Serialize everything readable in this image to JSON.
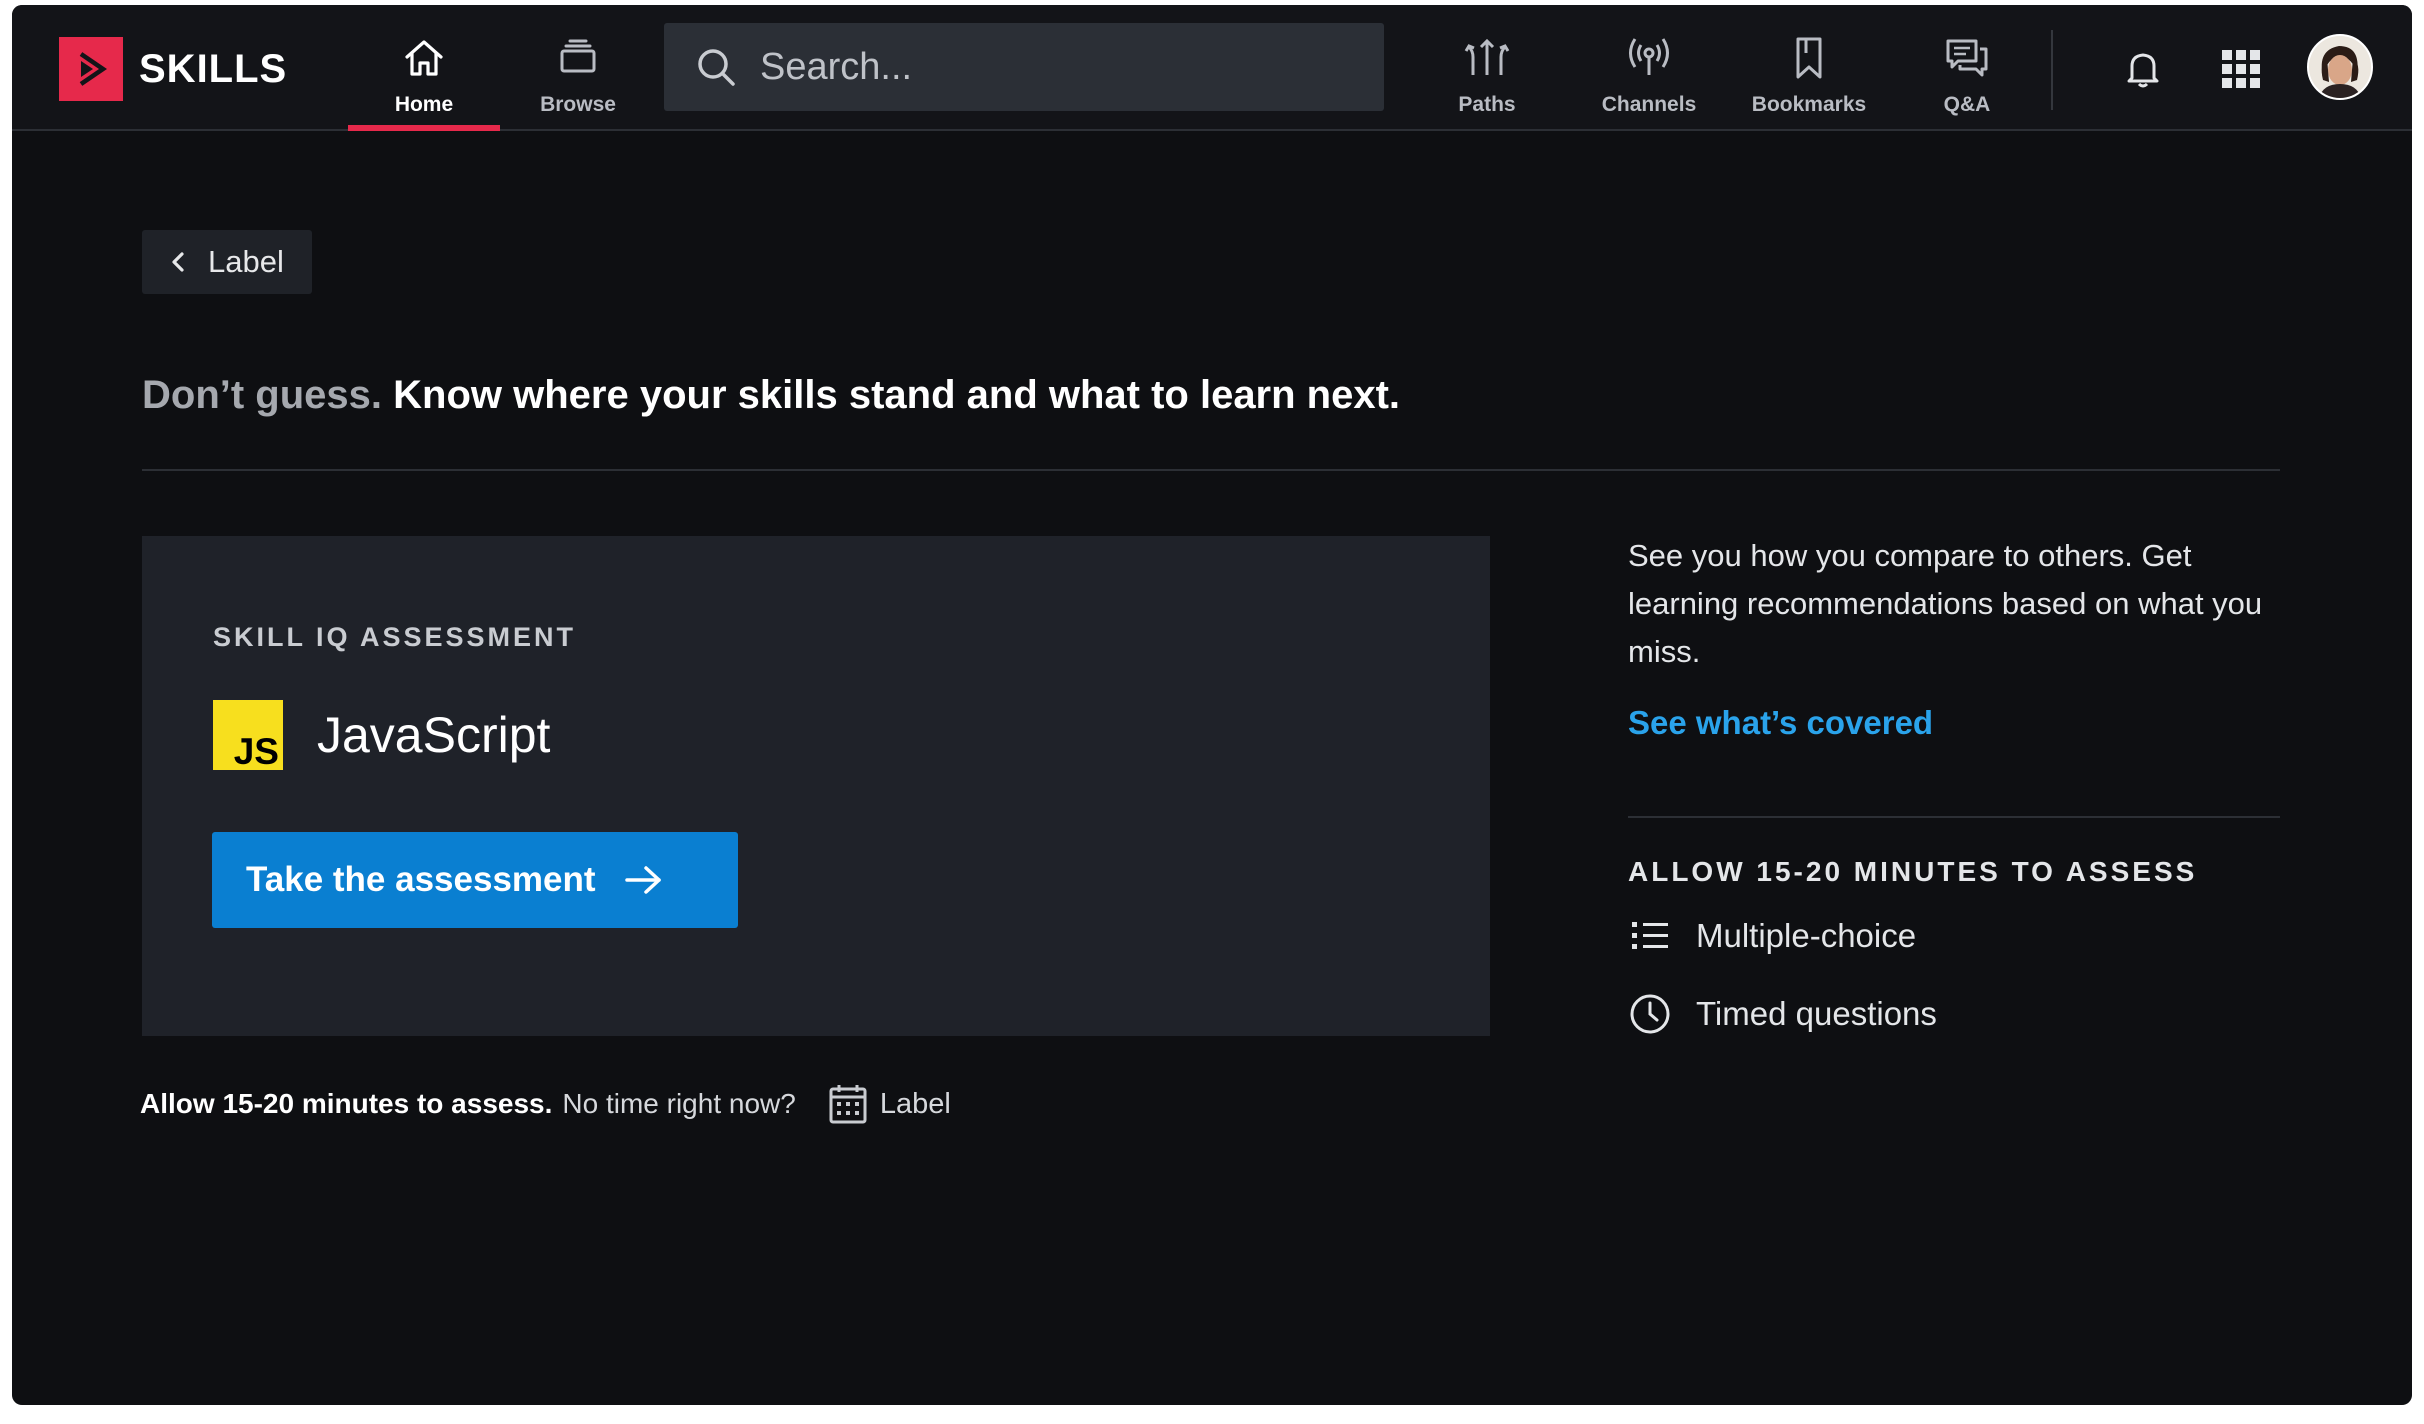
{
  "app": {
    "name": "SKILLS"
  },
  "nav": {
    "home": "Home",
    "browse": "Browse",
    "paths": "Paths",
    "channels": "Channels",
    "bookmarks": "Bookmarks",
    "qa": "Q&A"
  },
  "search": {
    "placeholder": "Search..."
  },
  "back": {
    "label": "Label"
  },
  "headline": {
    "muted": "Don’t guess.",
    "strong": "Know where your skills stand and what to learn next."
  },
  "card": {
    "eyebrow": "SKILL IQ ASSESSMENT",
    "badge": "JS",
    "title": "JavaScript",
    "cta": "Take the assessment"
  },
  "footnote": {
    "bold": "Allow 15-20 minutes to assess.",
    "plain": "No time right now?",
    "calendar_label": "Label"
  },
  "side": {
    "description": "See you how you compare to others. Get learning recommendations based on what you miss.",
    "link": "See what’s covered",
    "eyebrow": "ALLOW 15-20 MINUTES TO ASSESS",
    "features": [
      "Multiple-choice",
      "Timed questions"
    ]
  },
  "colors": {
    "brand": "#e6294b",
    "primary": "#0a7fd1",
    "link": "#2aa3eb",
    "js_yellow": "#f7df1e",
    "background": "#0e0f12",
    "card": "#1f2229"
  },
  "icons": {
    "logo": "play-logo-icon",
    "home": "home-icon",
    "browse": "browse-stack-icon",
    "search": "search-icon",
    "paths": "paths-arrows-icon",
    "channels": "broadcast-icon",
    "bookmarks": "bookmark-icon",
    "qa": "chat-bubbles-icon",
    "notifications": "bell-icon",
    "apps": "grid-icon",
    "back": "chevron-left-icon",
    "cta": "arrow-right-icon",
    "calendar": "calendar-icon",
    "list": "list-icon",
    "clock": "clock-icon"
  }
}
